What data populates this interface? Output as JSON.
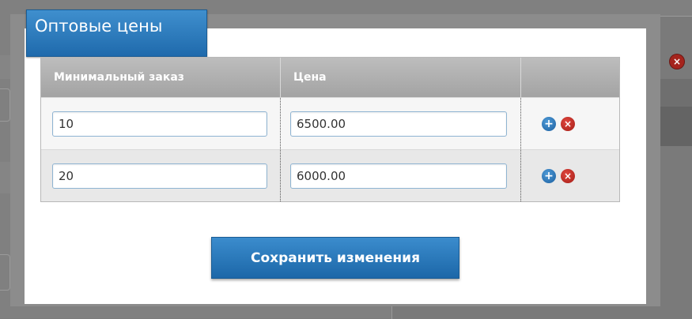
{
  "dialog": {
    "title": "Оптовые цены",
    "table": {
      "headers": [
        "Минимальный заказ",
        "Цена",
        ""
      ],
      "rows": [
        {
          "min_order": "10",
          "price": "6500.00"
        },
        {
          "min_order": "20",
          "price": "6000.00"
        }
      ]
    },
    "row_icons": {
      "add": "+",
      "remove": "×"
    },
    "save_label": "Сохранить изменения"
  },
  "background": {
    "close_icon": "×"
  },
  "colors": {
    "accent": "#1f6aac",
    "remove": "#a41e17",
    "header": "#b0b0b0"
  }
}
